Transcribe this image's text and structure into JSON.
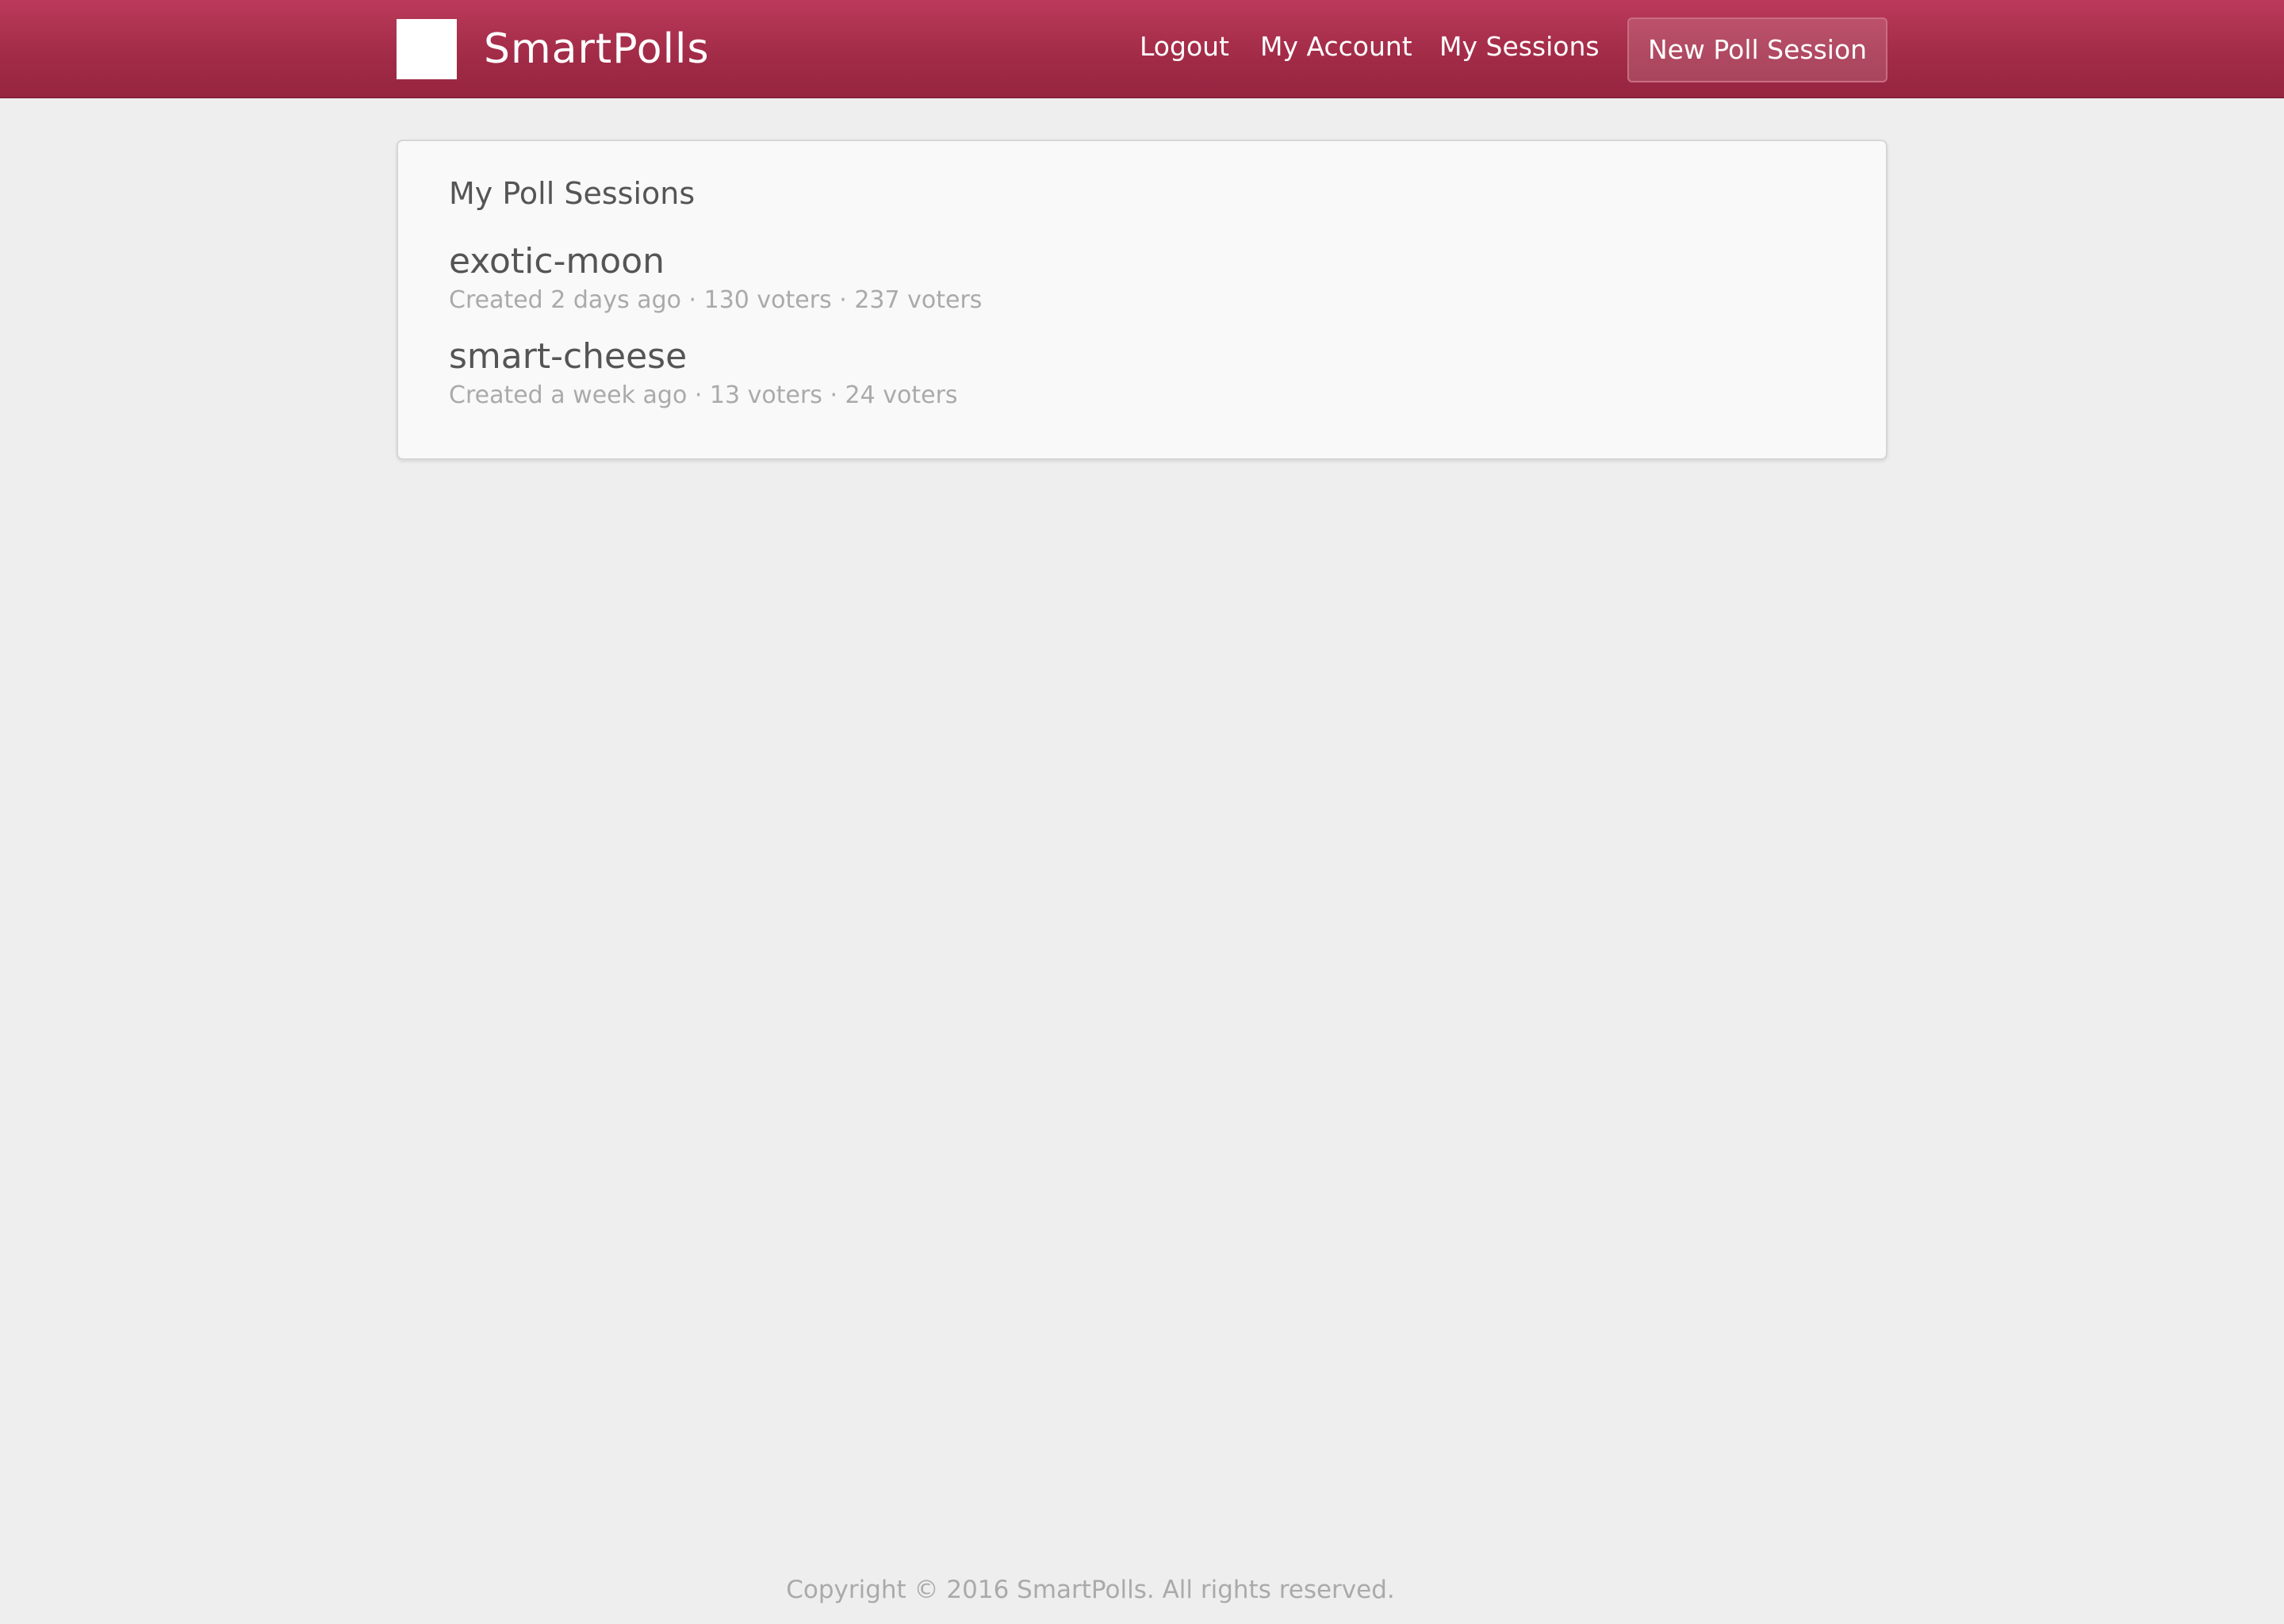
{
  "header": {
    "brand": "SmartPolls",
    "logo": "square-logo-icon",
    "nav": {
      "logout": "Logout",
      "my_account": "My Account",
      "my_sessions": "My Sessions"
    },
    "new_session_button": "New Poll Session"
  },
  "main": {
    "card_title": "My Poll Sessions",
    "sessions": [
      {
        "name": "exotic-moon",
        "meta": "Created 2 days ago · 130 voters · 237 voters"
      },
      {
        "name": "smart-cheese",
        "meta": "Created a week ago · 13 voters · 24 voters"
      }
    ]
  },
  "footer": {
    "copyright": "Copyright © 2016 SmartPolls. All rights reserved."
  },
  "colors": {
    "header_top": "#bb3a5b",
    "header_bottom": "#962540",
    "background": "#eeeeee",
    "card_background": "#f9f9f9",
    "muted_text": "#aaaaaa",
    "primary_text": "#555555"
  }
}
